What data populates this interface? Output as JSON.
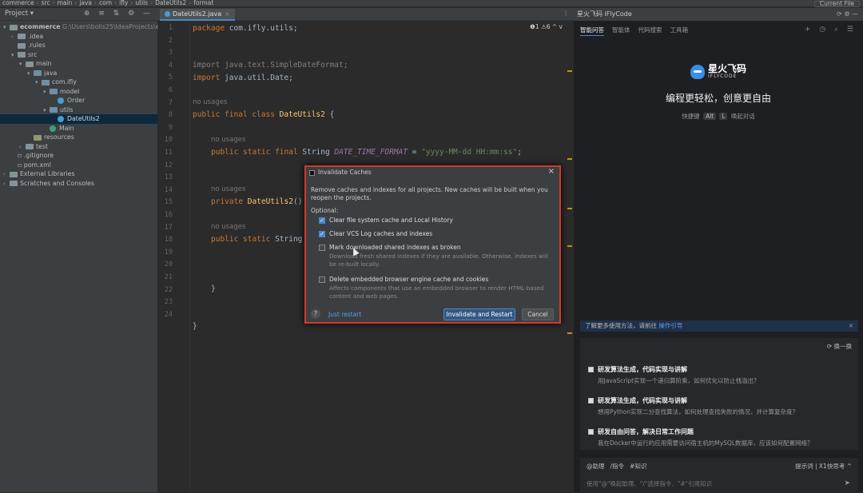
{
  "topbar": {
    "crumbs": [
      "commerce",
      "src",
      "main",
      "java",
      "com",
      "ifly",
      "utils",
      "DateUtils2",
      "format"
    ],
    "current_file": "Current File"
  },
  "project": {
    "title": "Project",
    "tools": "⊕ ≡ ⇅ ⚙ —"
  },
  "tree": [
    {
      "label": "ecommerce",
      "path": "G:\\Users\\bolis25\\IdeaProjects\\ecomm",
      "indent": 0,
      "arrow": "▾",
      "kind": "fold",
      "bold": true
    },
    {
      "label": ".idea",
      "indent": 1,
      "arrow": "›",
      "kind": "fold"
    },
    {
      "label": ".rules",
      "indent": 1,
      "arrow": "",
      "kind": "fold"
    },
    {
      "label": "src",
      "indent": 1,
      "arrow": "▾",
      "kind": "fold"
    },
    {
      "label": "main",
      "indent": 2,
      "arrow": "▾",
      "kind": "fold"
    },
    {
      "label": "java",
      "indent": 3,
      "arrow": "▾",
      "kind": "fold pkg"
    },
    {
      "label": "com.ifly",
      "indent": 4,
      "arrow": "▾",
      "kind": "fold pkg"
    },
    {
      "label": "model",
      "indent": 5,
      "arrow": "▾",
      "kind": "fold pkg"
    },
    {
      "label": "Order",
      "indent": 6,
      "arrow": "",
      "kind": "cls"
    },
    {
      "label": "utils",
      "indent": 5,
      "arrow": "▾",
      "kind": "fold pkg"
    },
    {
      "label": "DateUtils2",
      "indent": 6,
      "arrow": "",
      "kind": "cls",
      "sel": true
    },
    {
      "label": "Main",
      "indent": 5,
      "arrow": "",
      "kind": "cls main"
    },
    {
      "label": "resources",
      "indent": 3,
      "arrow": "",
      "kind": "fold res"
    },
    {
      "label": "test",
      "indent": 2,
      "arrow": "›",
      "kind": "fold"
    },
    {
      "label": ".gitignore",
      "indent": 1,
      "arrow": "",
      "kind": "file"
    },
    {
      "label": "pom.xml",
      "indent": 1,
      "arrow": "",
      "kind": "file"
    },
    {
      "label": "External Libraries",
      "indent": 0,
      "arrow": "›",
      "kind": "fold"
    },
    {
      "label": "Scratches and Consoles",
      "indent": 0,
      "arrow": "›",
      "kind": "fold"
    }
  ],
  "editor": {
    "tab": "DateUtils2.java",
    "errors": "❶1 ⚠6 ^ v",
    "line_numbers": [
      "1",
      "2",
      "3",
      "4",
      "5",
      "6",
      "7",
      "8",
      "9",
      "10",
      "11",
      "12",
      "13",
      "14",
      "15",
      "16",
      "17",
      "18",
      "19",
      "20",
      "21",
      "22",
      "23",
      "24"
    ],
    "code": {
      "l1_kw": "package",
      "l1_rest": " com.ifly.utils;",
      "l4": "import java.text.SimpleDateFormat;",
      "l5_kw": "import",
      "l5_rest": " java.util.Date;",
      "usage": "no usages",
      "l7_kw": "public final class ",
      "l7_name": "DateUtils2",
      "l7_end": " {",
      "l9_kw": "public static final ",
      "l9_type": "String ",
      "l9_fld": "DATE_TIME_FORMAT",
      "l9_eq": " = ",
      "l9_str": "\"yyyy-MM-dd HH:mm:ss\"",
      "l9_end": ";",
      "l12_kw": "private ",
      "l12_name": "DateUtils2",
      "l12_end": "()",
      "l14_kw": "public static ",
      "l14_type": "String",
      "l18": "}",
      "l21": "}"
    }
  },
  "dialog": {
    "title": "Invalidate Caches",
    "description": "Remove caches and indexes for all projects. New caches will be built when you reopen the projects.",
    "optional": "Optional:",
    "options": [
      {
        "label": "Clear file system cache and Local History",
        "checked": "✓",
        "note": ""
      },
      {
        "label": "Clear VCS Log caches and indexes",
        "checked": "✓",
        "note": ""
      },
      {
        "label": "Mark downloaded shared indexes as broken",
        "checked": "",
        "note": "Download fresh shared indexes if they are available. Otherwise, indexes will be re-built locally."
      },
      {
        "label": "Delete embedded browser engine cache and cookies",
        "checked": "",
        "note": "Affects components that use an embedded browser to render HTML-based content and web pages."
      }
    ],
    "help": "?",
    "just_restart": "Just restart",
    "primary": "Invalidate and Restart",
    "cancel": "Cancel"
  },
  "assistant": {
    "header": "星火飞码 iFlyCode",
    "tabs": [
      "智能问答",
      "智能体",
      "代码搜索",
      "工具箱"
    ],
    "logo_cn": "星火飞码",
    "logo_en": "IFLYCODE",
    "slogan": "编程更轻松，创意更自由",
    "shortcut_prefix": "快捷键",
    "key1": "Alt",
    "key2": "L",
    "shortcut_suffix": "唤起对话",
    "tip_text": "了解更多使用方法，请前往",
    "tip_link": "操作引导",
    "refresh": "⟳ 换一换",
    "cards": [
      {
        "title": "研发算法生成，代码实现与讲解",
        "sub": "用JavaScript实现一个递归算阶乘，如何优化以防止栈溢出？"
      },
      {
        "title": "研发算法生成，代码实现与讲解",
        "sub": "想用Python实现二分查找算法，如何处理查找失败的情况，并计算复杂度？"
      },
      {
        "title": "研发自由问答，解决日常工作问题",
        "sub": "我在Docker中运行的应用需要访问宿主机的MySQL数据库，应该如何配置网络？"
      }
    ],
    "input_tools": [
      "@助理",
      "/指令",
      "#知识"
    ],
    "input_right": "提示词 | X1快思考",
    "placeholder": "使用\"@\"唤起助理、\"/\"选择指令、\"#\"引用知识"
  }
}
